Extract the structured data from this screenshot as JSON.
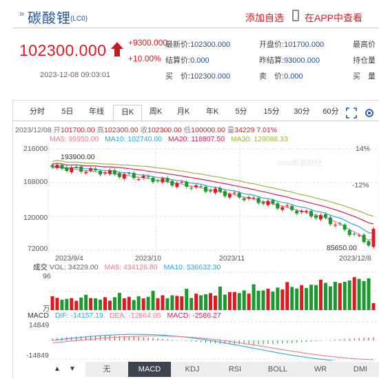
{
  "header": {
    "arrow": "»",
    "name": "碳酸锂",
    "code": "(LC0)",
    "add_watch": "添加自选",
    "app_view": "在APP中查看"
  },
  "quote": {
    "price": "102300.000",
    "change": "+9300.000",
    "change_pct": "+10.00%",
    "datetime": "2023-12-08 09:03:01",
    "fields": [
      {
        "label": "最新价:",
        "value": "102300.000"
      },
      {
        "label": "结算价:",
        "value": "0.000"
      },
      {
        "label": "买　价:",
        "value": "102300.000"
      },
      {
        "label": "开盘价:",
        "value": "101700.000"
      },
      {
        "label": "昨结算:",
        "value": "93000.000"
      },
      {
        "label": "卖　价:",
        "value": "0.000"
      },
      {
        "label": "最高价",
        "value": ""
      },
      {
        "label": "持仓量",
        "value": ""
      },
      {
        "label": "买　量",
        "value": ""
      }
    ]
  },
  "tabs": [
    "分时",
    "5日",
    "年线",
    "日K",
    "周K",
    "月K",
    "年K",
    "5分",
    "15分",
    "30分",
    "60分"
  ],
  "active_tab": "日K",
  "info_line": {
    "date": "2023/12/08",
    "open_label": "开",
    "open": "101700.00",
    "high_label": "高",
    "high": "102300.00",
    "close_label": "收",
    "close": "102300.00",
    "low_label": "低",
    "low": "100000.00",
    "vol_label": "量",
    "vol": "34229",
    "pct": "7.01%"
  },
  "ma_line": {
    "ma5": "MA5: 95950.00",
    "ma10": "MA10: 102740.00",
    "ma20": "MA20: 118807.50",
    "ma30": "MA30: 129088.33"
  },
  "colors": {
    "ma5": "#e97b8e",
    "ma10": "#2ba9d8",
    "ma20": "#d81b5a",
    "ma30": "#9bb53b",
    "up": "#e4161f",
    "down": "#1a9a2e"
  },
  "chart_data": {
    "type": "candlestick",
    "y_ticks": [
      "216000",
      "168000",
      "120000",
      "72000"
    ],
    "pct_ticks": [
      "14%",
      "-12%"
    ],
    "x_labels": [
      "2023/9/4",
      "2023/10",
      "2023/11",
      "2023/12/8"
    ],
    "high_label": "193900.00",
    "low_label": "85650.00",
    "watermark": "sina新浪财经"
  },
  "volume": {
    "title": "成交",
    "vol": "VOL: 34229.00",
    "ma5": "MA5: 434126.80",
    "ma10": "MA10: 536632.30",
    "top": "96",
    "bottom": "万"
  },
  "macd": {
    "title": "MACD",
    "dif": "DIF: -14157.19",
    "dea": "DEA: -12864.06",
    "macd": "MACD: -2586.27",
    "top": "14849",
    "bottom": "-14849"
  },
  "bottom_tabs": [
    "无",
    "MACD",
    "KDJ",
    "RSI",
    "BOLL",
    "WR",
    "DMI"
  ],
  "bottom_active": "MACD",
  "nav": {
    "up": "▲",
    "down": "▼"
  }
}
